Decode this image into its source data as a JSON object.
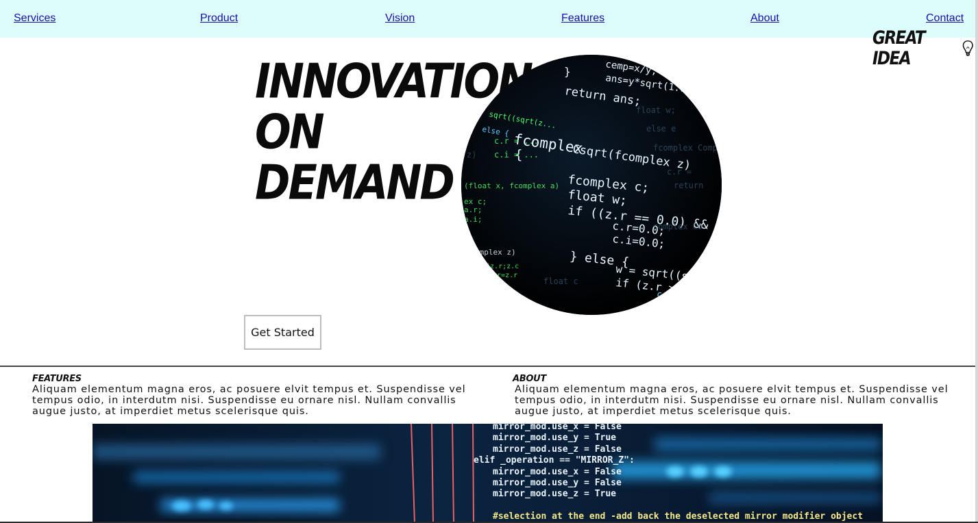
{
  "nav": {
    "items": [
      "Services",
      "Product",
      "Vision",
      "Features",
      "About",
      "Contact"
    ]
  },
  "logo": {
    "text": "GREAT IDEA",
    "icon": "lightbulb-icon"
  },
  "hero": {
    "title_lines": [
      "INNOVATION",
      "ON",
      "DEMAND"
    ],
    "cta_label": "Get Started",
    "image": "code-screen-circle"
  },
  "features": {
    "heading": "FEATURES",
    "body": "Aliquam elementum magna eros, ac posuere elvit tempus et. Suspendisse vel tempus odio, in interdutm nisi. Suspendisse eu ornare nisl. Nullam convallis augue justo, at imperdiet metus scelerisque quis."
  },
  "about": {
    "heading": "ABOUT",
    "body": "Aliquam elementum magna eros, ac posuere elvit tempus et. Suspendisse vel tempus odio, in interdutm nisi. Suspendisse eu ornare nisl. Nullam convallis augue justo, at imperdiet metus scelerisque quis."
  },
  "colors": {
    "nav_bg": "#dcfdfb",
    "link": "#1a0dab",
    "code_green": "#4cff6a",
    "code_blue": "#5fc8ff"
  }
}
